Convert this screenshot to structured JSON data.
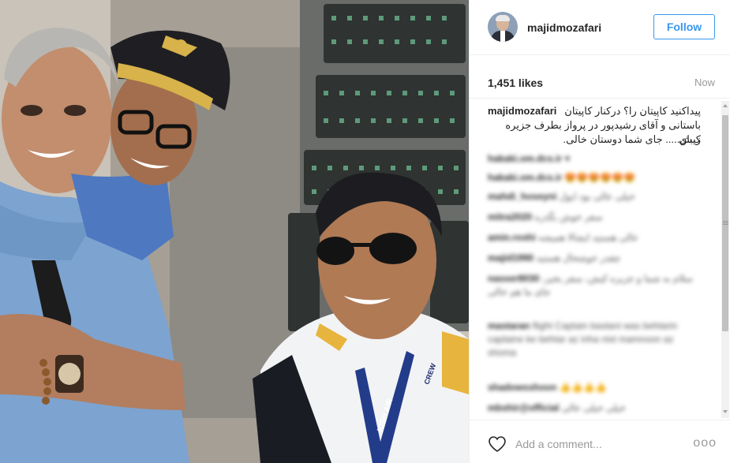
{
  "header": {
    "username": "majidmozafari",
    "follow_label": "Follow"
  },
  "meta": {
    "likes": "1,451 likes",
    "time": "Now"
  },
  "caption": {
    "username": "majidmozafari",
    "text_line1": "پیداکنید کاپیتان را؟ درکنار کاپیتان",
    "text_line2": "باستانی و آقای رشیدپور در پرواز بطرف جزیره زیبای",
    "text_line3": "کیش..... جای شما دوستان خالی."
  },
  "comments": [
    {
      "user": "hakaki.om.dcs.ir",
      "text": "♥"
    },
    {
      "user": "hakaki.om.dcs.ir",
      "text": "😍😍😍😍😍😍"
    },
    {
      "user": "mahdi_hoseyni",
      "text": "خیلی عالی بود ایول"
    },
    {
      "user": "mitra2020",
      "text": "سفر خوش بگذره"
    },
    {
      "user": "amin.roshi",
      "text": "عالی هستید ایشالا همیشه"
    },
    {
      "user": "majid1990",
      "text": "چقدر خوشحال هستید"
    },
    {
      "user": "nasser8030",
      "text": "سلام به شما و جزیره کیش، سفر بخیر، جای ما هم خالی"
    },
    {
      "user": "mastaran",
      "text": "flight Captain bastani was behtarin captaine ke behtar az inha nist mamnoon az shoma"
    },
    {
      "user": "shadowsshoon",
      "text": "👍👍👍👍"
    },
    {
      "user": "mbshir@official",
      "text": "خیلی خیلی عالی"
    }
  ],
  "footer": {
    "comment_placeholder": "Add a comment...",
    "more_label": "ooo"
  },
  "photo": {
    "captain_badge_text": "CREW",
    "lanyard_text": "KISH AIR"
  },
  "colors": {
    "follow_blue": "#3897f0",
    "muted_gray": "#999999"
  }
}
